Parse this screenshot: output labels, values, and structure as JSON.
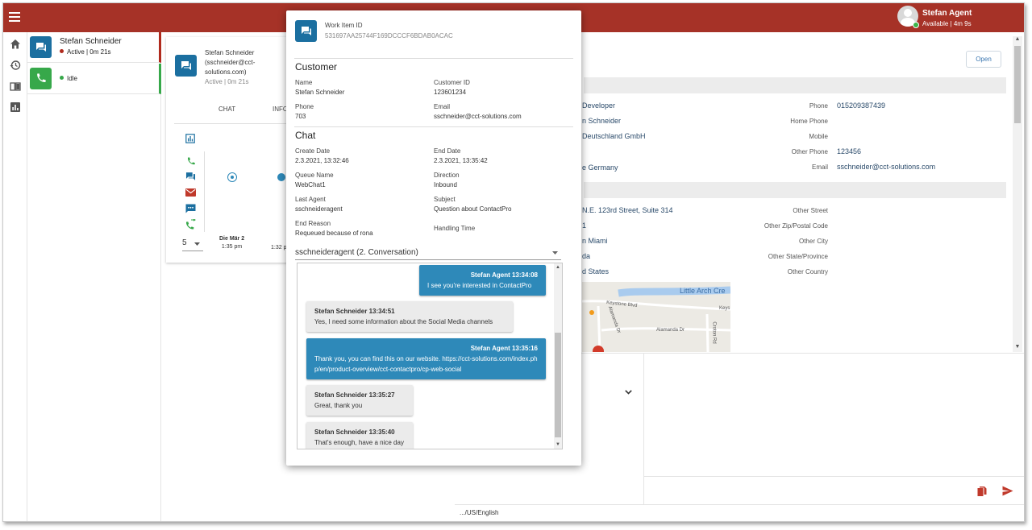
{
  "topbar": {
    "user_name": "Stefan Agent",
    "user_status": "Available | 4m 9s"
  },
  "sessions": [
    {
      "name": "Stefan Schneider",
      "status": "Active | 0m 21s"
    },
    {
      "name": "",
      "status": "Idle"
    }
  ],
  "interaction_card": {
    "contact_line1": "Stefan Schneider",
    "contact_line2": "(sschneider@cct-",
    "contact_line3": "solutions.com)",
    "status": "Active | 0m 21s",
    "tabs": [
      "CHAT",
      "INFO"
    ],
    "page_size": "5",
    "timeline": [
      {
        "date": "Die Mär 2",
        "time": "1:35 pm"
      },
      {
        "date": "",
        "time": "1:32 p"
      }
    ]
  },
  "contact_detail": {
    "open_label": "Open",
    "left_values": [
      "Developer",
      "n Schneider",
      "Deutschland GmbH",
      "e Germany"
    ],
    "right_fields": [
      {
        "label": "Phone",
        "value": "015209387439"
      },
      {
        "label": "Home Phone",
        "value": ""
      },
      {
        "label": "Mobile",
        "value": ""
      },
      {
        "label": "Other Phone",
        "value": "123456"
      },
      {
        "label": "Email",
        "value": "sschneider@cct-solutions.com"
      }
    ],
    "address_values": [
      "N.E. 123rd Street, Suite 314",
      "1",
      "n Miami",
      "da",
      "d States"
    ],
    "address_fields": [
      "Other Street",
      "Other Zip/Postal Code",
      "Other City",
      "Other State/Province",
      "Other Country"
    ],
    "map_labels": [
      "Little Arch Cre",
      "Keystone Blvd",
      "Keys",
      "Alamanda Dr",
      "Alamanda Dr",
      "Croton Rd"
    ]
  },
  "footer_text": ".../US/English",
  "popup": {
    "work_item_label": "Work Item ID",
    "work_item_id": "531697AA25744F169DCCCF6BDAB0ACAC",
    "customer_heading": "Customer",
    "customer_fields": [
      {
        "label": "Name",
        "value": "Stefan Schneider"
      },
      {
        "label": "Customer ID",
        "value": "123601234"
      },
      {
        "label": "Phone",
        "value": "703"
      },
      {
        "label": "Email",
        "value": "sschneider@cct-solutions.com"
      }
    ],
    "chat_heading": "Chat",
    "chat_fields": [
      {
        "label": "Create Date",
        "value": "2.3.2021, 13:32:46"
      },
      {
        "label": "End Date",
        "value": "2.3.2021, 13:35:42"
      },
      {
        "label": "Queue Name",
        "value": "WebChat1"
      },
      {
        "label": "Direction",
        "value": "Inbound"
      },
      {
        "label": "Last Agent",
        "value": "sschneideragent"
      },
      {
        "label": "Subject",
        "value": "Question about ContactPro"
      },
      {
        "label": "End Reason",
        "value": "Requeued because of rona"
      },
      {
        "label": "Handling Time",
        "value": ""
      }
    ],
    "conversation_select": "sschneideragent (2. Conversation)",
    "messages": [
      {
        "role": "agent",
        "who": "Stefan Agent 13:34:08",
        "text": "I see you're interested in ContactPro"
      },
      {
        "role": "cust",
        "who": "Stefan Schneider 13:34:51",
        "text": "Yes, I need some information about the Social Media channels"
      },
      {
        "role": "agent",
        "who": "Stefan Agent 13:35:16",
        "text": "Thank you, you can find this on our website. https://cct-solutions.com/index.php/en/product-overview/cct-contactpro/cp-web-social"
      },
      {
        "role": "cust",
        "who": "Stefan Schneider 13:35:27",
        "text": "Great, thank you"
      },
      {
        "role": "cust",
        "who": "Stefan Schneider 13:35:40",
        "text": "That's enough, have a nice day"
      }
    ]
  },
  "colors": {
    "brand": "#a63227",
    "chat_blue": "#1b6fa0",
    "agent_bubble": "#2e89b9",
    "idle_green": "#37a84a",
    "active_red": "#b02a1d"
  }
}
